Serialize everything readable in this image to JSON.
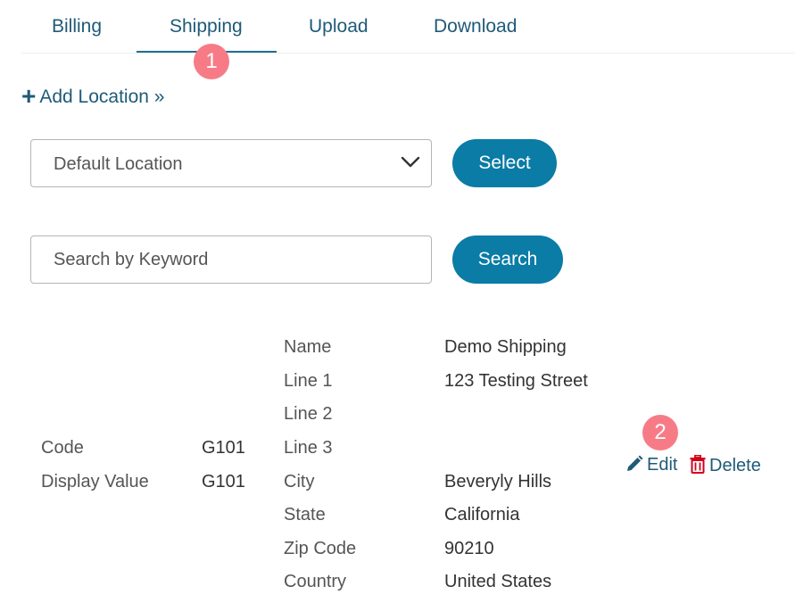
{
  "tabs": [
    {
      "label": "Billing"
    },
    {
      "label": "Shipping"
    },
    {
      "label": "Upload"
    },
    {
      "label": "Download"
    }
  ],
  "active_tab": "Shipping",
  "badges": {
    "tab": "1",
    "actions": "2"
  },
  "add_location": {
    "label": "Add Location »",
    "icon": "plus-icon"
  },
  "location_select": {
    "value": "Default Location",
    "icon": "chevron-down-icon"
  },
  "select_button": {
    "label": "Select"
  },
  "search": {
    "placeholder": "Search by Keyword"
  },
  "search_button": {
    "label": "Search"
  },
  "record": {
    "left": [
      {
        "label": "Code",
        "value": "G101"
      },
      {
        "label": "Display Value",
        "value": "G101"
      }
    ],
    "address": [
      {
        "label": "Name",
        "value": "Demo Shipping"
      },
      {
        "label": "Line 1",
        "value": "123 Testing Street"
      },
      {
        "label": "Line 2",
        "value": ""
      },
      {
        "label": "Line 3",
        "value": ""
      },
      {
        "label": "City",
        "value": "Beveryly Hills"
      },
      {
        "label": "State",
        "value": "California"
      },
      {
        "label": "Zip Code",
        "value": "90210"
      },
      {
        "label": "Country",
        "value": "United States"
      }
    ]
  },
  "actions": {
    "edit": {
      "label": "Edit",
      "icon": "pencil-icon"
    },
    "delete": {
      "label": "Delete",
      "icon": "trash-icon"
    }
  },
  "colors": {
    "primary": "#0a7ca6",
    "link": "#1f5a78",
    "badge": "#f77b86",
    "delete_icon": "#d0021b"
  }
}
